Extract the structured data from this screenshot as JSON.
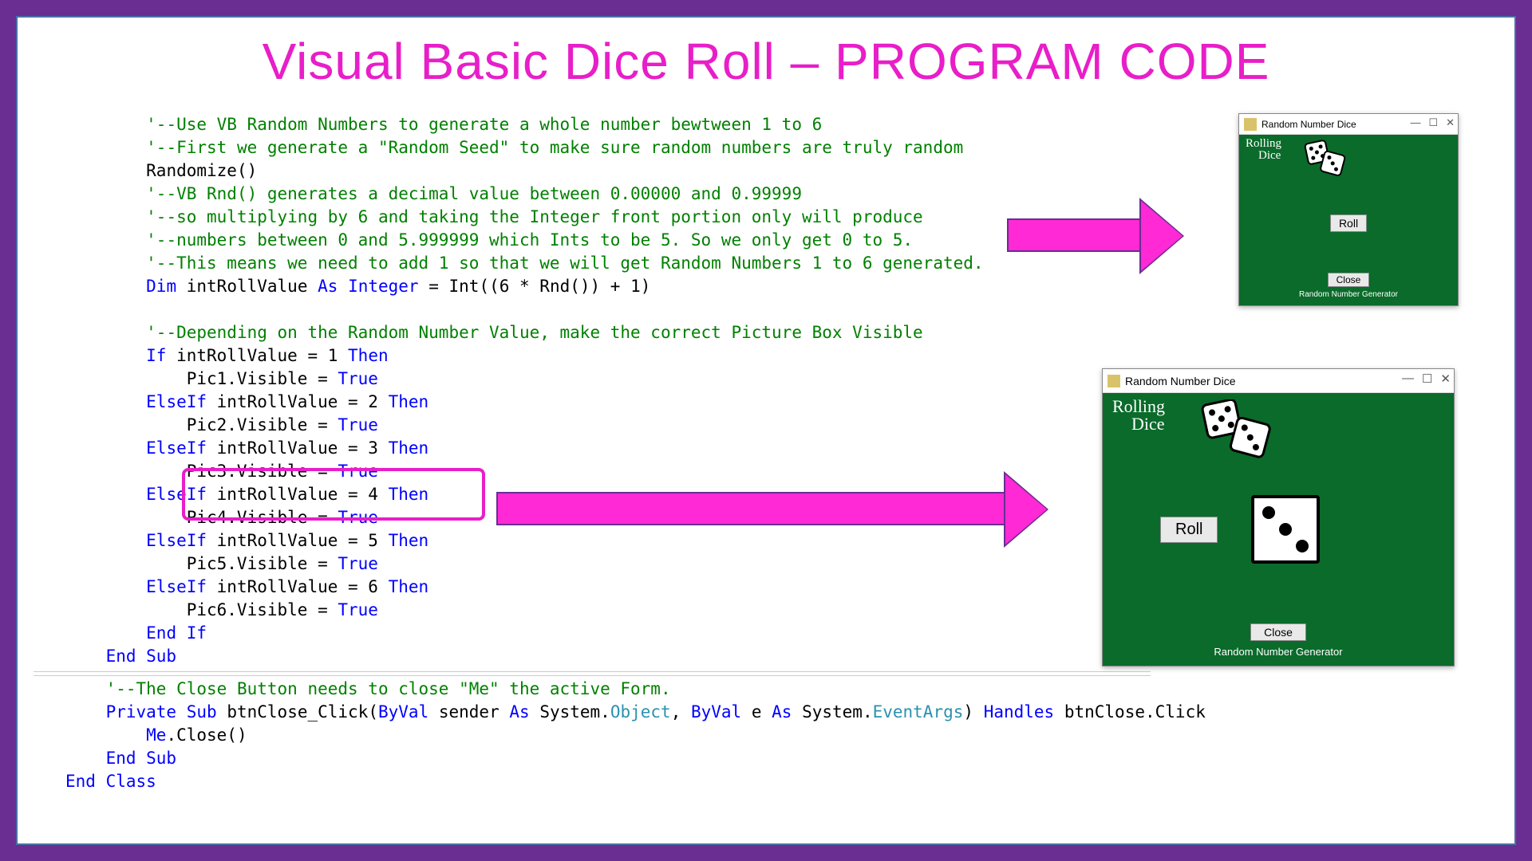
{
  "title": "Visual Basic Dice Roll – PROGRAM CODE",
  "code": {
    "c1": "'--Use VB Random Numbers to generate a whole number bewtween 1 to 6",
    "c2": "'--First we generate a \"Random Seed\" to make sure random numbers are truly random",
    "l3": "Randomize()",
    "c4": "'--VB Rnd() generates a decimal value between 0.00000 and 0.99999",
    "c5": "'--so multiplying by 6 and taking the Integer front portion only will produce",
    "c6": "'--numbers between 0 and 5.999999 which Ints to be 5. So we only get 0 to 5.",
    "c7": "'--This means we need to add 1 so that we will get Random Numbers 1 to 6 generated.",
    "dim": "Dim",
    "var": "intRollValue",
    "as": "As",
    "integer": "Integer",
    "assign": " = Int((6 * Rnd()) + 1)",
    "c8": "'--Depending on the Random Number Value, make the correct Picture Box Visible",
    "if": "If",
    "elseif": "ElseIf",
    "then": "Then",
    "endif": "End If",
    "endsub": "End Sub",
    "true": "True",
    "cond1": " intRollValue = 1 ",
    "pic1": "Pic1.Visible = ",
    "cond2": " intRollValue = 2 ",
    "pic2": "Pic2.Visible = ",
    "cond3": " intRollValue = 3 ",
    "pic3": "Pic3.Visible = ",
    "cond4": " intRollValue = 4 ",
    "pic4": "Pic4.Visible = ",
    "cond5": " intRollValue = 5 ",
    "pic5": "Pic5.Visible = ",
    "cond6": " intRollValue = 6 ",
    "pic6": "Pic6.Visible = ",
    "c9": "'--The Close Button needs to close \"Me\" the active Form.",
    "private": "Private",
    "sub": "Sub",
    "fn": "btnClose_Click(",
    "byval": "ByVal",
    "sender": " sender ",
    "asw": "As",
    "obj": "Object",
    "comma": ", ",
    "e": " e ",
    "args": "EventArgs",
    "handles": " Handles",
    "handler": " btnClose.Click",
    "sys": " System.",
    "me": "Me",
    "close": ".Close()",
    "endclass": "End Class"
  },
  "app": {
    "title": "Random Number Dice",
    "logo1": "Rolling",
    "logo2": "Dice",
    "roll": "Roll",
    "close": "Close",
    "gen": "Random Number Generator"
  }
}
